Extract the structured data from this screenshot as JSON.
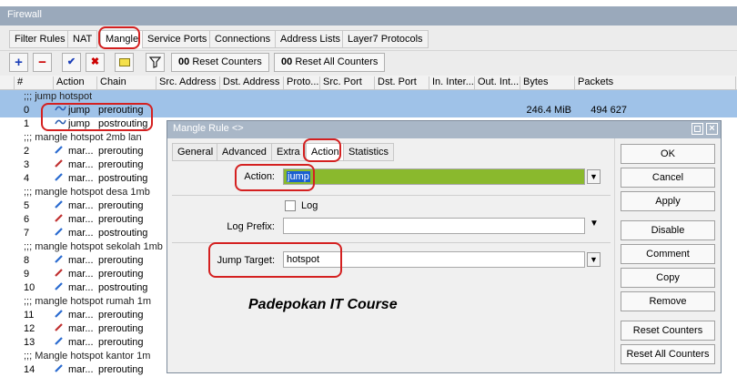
{
  "window": {
    "title": "Firewall"
  },
  "tabs": [
    "Filter Rules",
    "NAT",
    "Mangle",
    "Service Ports",
    "Connections",
    "Address Lists",
    "Layer7 Protocols"
  ],
  "toolbar": {
    "reset_counters": "Reset Counters",
    "reset_all_counters": "Reset All Counters",
    "counter_icon": "00"
  },
  "columns": [
    "#",
    "Action",
    "Chain",
    "Src. Address",
    "Dst. Address",
    "Proto...",
    "Src. Port",
    "Dst. Port",
    "In. Inter...",
    "Out. Int...",
    "Bytes",
    "Packets"
  ],
  "rows": [
    {
      "type": "comment",
      "text": ";;; jump hotspot",
      "selected": true
    },
    {
      "type": "rule",
      "num": "0",
      "action": "jump",
      "chain": "prerouting",
      "bytes": "246.4 MiB",
      "packets": "494 627",
      "selected": true
    },
    {
      "type": "rule",
      "num": "1",
      "action": "jump",
      "chain": "postrouting"
    },
    {
      "type": "comment",
      "text": ";;; mangle hotspot 2mb lan"
    },
    {
      "type": "rule",
      "num": "2",
      "action": "mar...",
      "chain": "prerouting"
    },
    {
      "type": "rule",
      "num": "3",
      "action": "mar...",
      "chain": "prerouting"
    },
    {
      "type": "rule",
      "num": "4",
      "action": "mar...",
      "chain": "postrouting"
    },
    {
      "type": "comment",
      "text": ";;; mangle hotspot desa 1mb"
    },
    {
      "type": "rule",
      "num": "5",
      "action": "mar...",
      "chain": "prerouting"
    },
    {
      "type": "rule",
      "num": "6",
      "action": "mar...",
      "chain": "prerouting"
    },
    {
      "type": "rule",
      "num": "7",
      "action": "mar...",
      "chain": "postrouting"
    },
    {
      "type": "comment",
      "text": ";;; mangle hotspot sekolah 1mb"
    },
    {
      "type": "rule",
      "num": "8",
      "action": "mar...",
      "chain": "prerouting"
    },
    {
      "type": "rule",
      "num": "9",
      "action": "mar...",
      "chain": "prerouting"
    },
    {
      "type": "rule",
      "num": "10",
      "action": "mar...",
      "chain": "postrouting"
    },
    {
      "type": "comment",
      "text": ";;; mangle hotspot rumah 1m"
    },
    {
      "type": "rule",
      "num": "11",
      "action": "mar...",
      "chain": "prerouting"
    },
    {
      "type": "rule",
      "num": "12",
      "action": "mar...",
      "chain": "prerouting"
    },
    {
      "type": "rule",
      "num": "13",
      "action": "mar...",
      "chain": "prerouting"
    },
    {
      "type": "comment",
      "text": ";;; Mangle hotspot kantor 1m"
    },
    {
      "type": "rule",
      "num": "14",
      "action": "mar...",
      "chain": "prerouting"
    }
  ],
  "dialog": {
    "title": "Mangle Rule <>",
    "tabs": [
      "General",
      "Advanced",
      "Extra",
      "Action",
      "Statistics"
    ],
    "action_label": "Action:",
    "action_value": "jump",
    "log_label": "Log",
    "log_prefix_label": "Log Prefix:",
    "log_prefix_value": "",
    "jump_target_label": "Jump Target:",
    "jump_target_value": "hotspot",
    "buttons": [
      "OK",
      "Cancel",
      "Apply",
      "Disable",
      "Comment",
      "Copy",
      "Remove",
      "Reset Counters",
      "Reset All Counters"
    ]
  },
  "watermark": "Padepokan IT Course",
  "colors": {
    "selected_row": "#9fc2e8",
    "action_field": "#8ab92d",
    "highlight": "#d42020"
  }
}
